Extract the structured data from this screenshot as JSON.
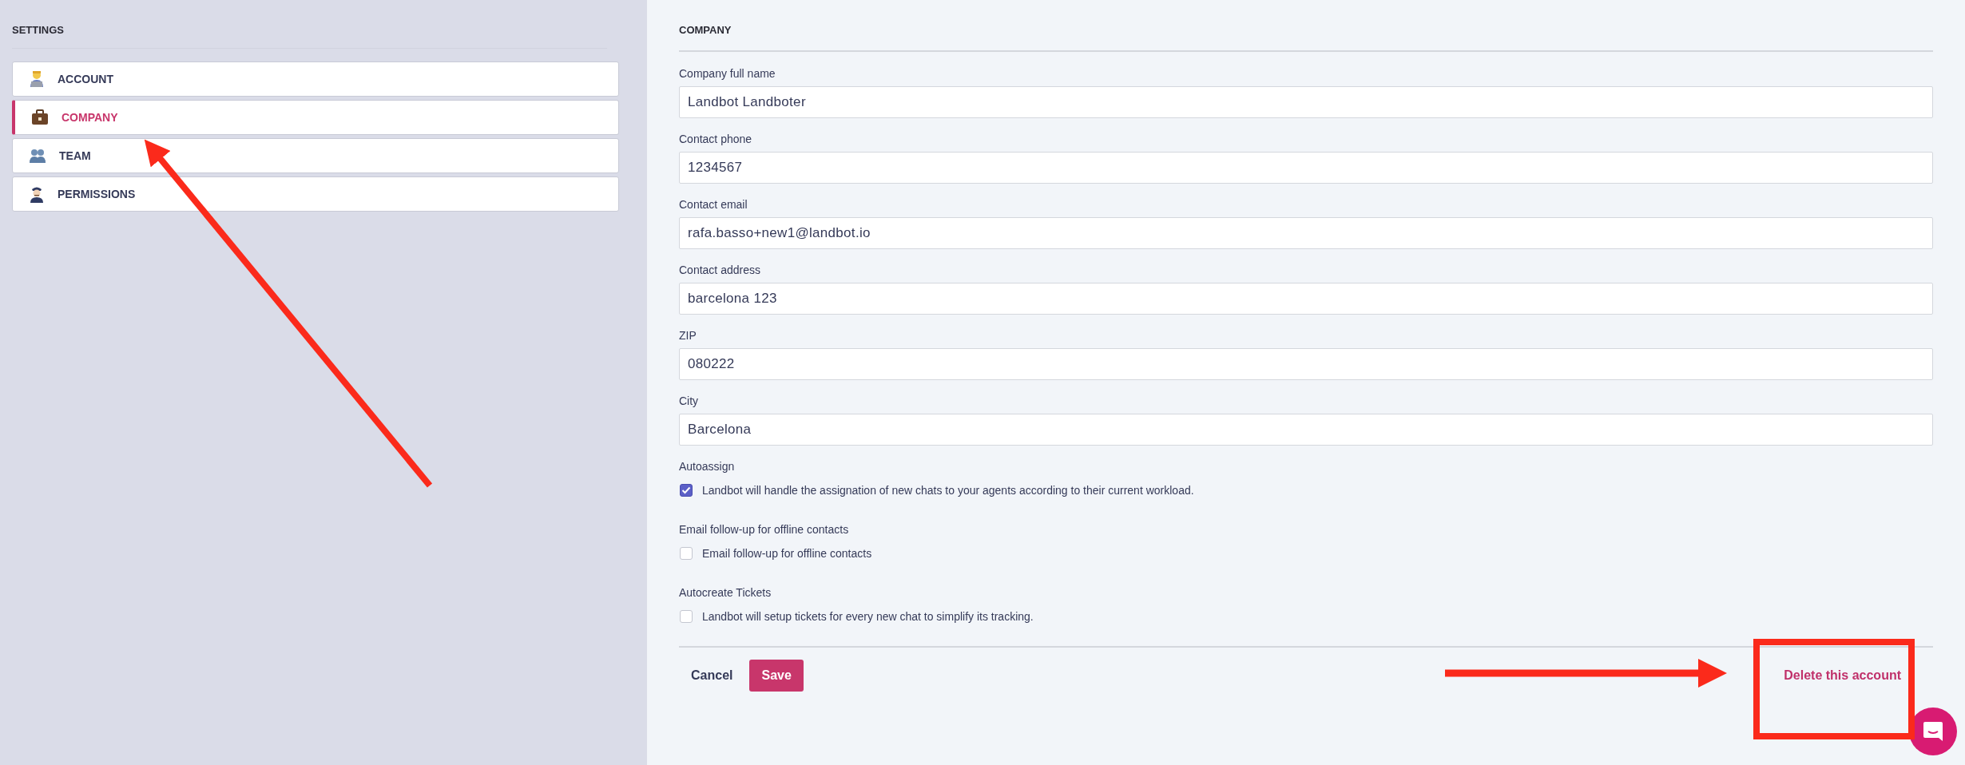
{
  "sidebar": {
    "title": "SETTINGS",
    "items": [
      {
        "label": "ACCOUNT",
        "selected": false
      },
      {
        "label": "COMPANY",
        "selected": true
      },
      {
        "label": "TEAM",
        "selected": false
      },
      {
        "label": "PERMISSIONS",
        "selected": false
      }
    ]
  },
  "form": {
    "title": "COMPANY",
    "fields": [
      {
        "label": "Company full name",
        "value": "Landbot Landboter"
      },
      {
        "label": "Contact phone",
        "value": "1234567"
      },
      {
        "label": "Contact email",
        "value": "rafa.basso+new1@landbot.io"
      },
      {
        "label": "Contact address",
        "value": "barcelona 123"
      },
      {
        "label": "ZIP",
        "value": "080222"
      },
      {
        "label": "City",
        "value": "Barcelona"
      }
    ],
    "options": [
      {
        "label": "Autoassign",
        "text": "Landbot will handle the assignation of new chats to your agents according to their current workload.",
        "checked": true
      },
      {
        "label": "Email follow-up for offline contacts",
        "text": "Email follow-up for offline contacts",
        "checked": false
      },
      {
        "label": "Autocreate Tickets",
        "text": "Landbot will setup tickets for every new chat to simplify its tracking.",
        "checked": false
      }
    ],
    "cancel": "Cancel",
    "save": "Save",
    "delete": "Delete this account"
  }
}
